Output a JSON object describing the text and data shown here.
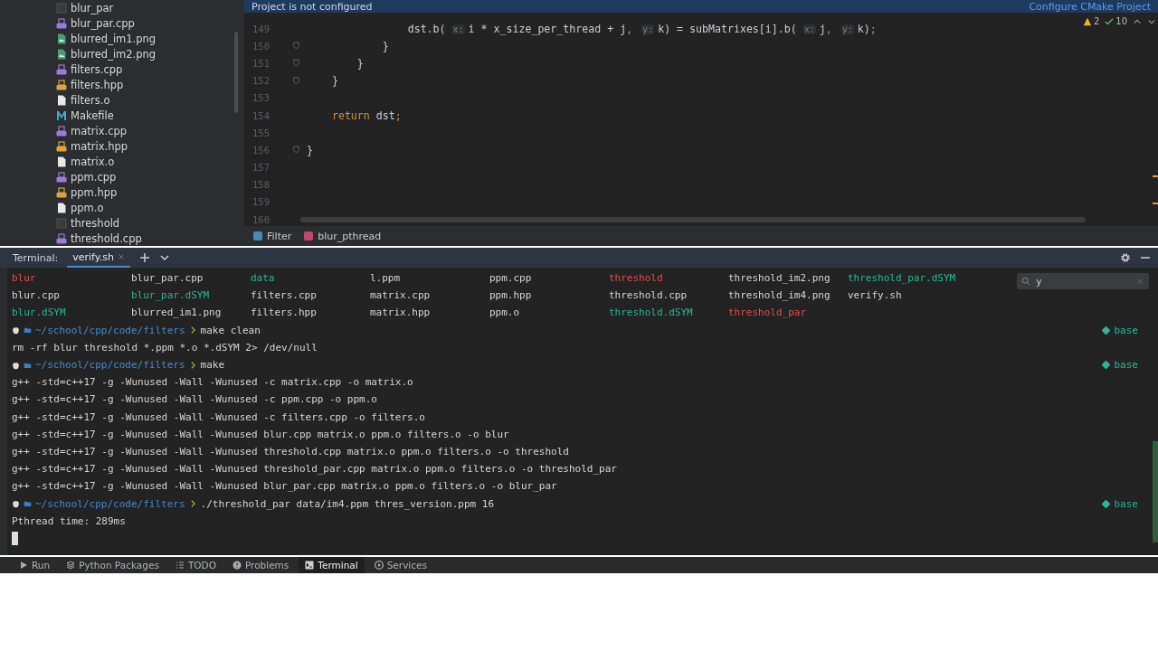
{
  "project_tree": {
    "items": [
      {
        "name": "blur_par",
        "kind": "exec"
      },
      {
        "name": "blur_par.cpp",
        "kind": "cpp"
      },
      {
        "name": "blurred_im1.png",
        "kind": "png"
      },
      {
        "name": "blurred_im2.png",
        "kind": "png"
      },
      {
        "name": "filters.cpp",
        "kind": "cpp"
      },
      {
        "name": "filters.hpp",
        "kind": "hpp"
      },
      {
        "name": "filters.o",
        "kind": "obj"
      },
      {
        "name": "Makefile",
        "kind": "make"
      },
      {
        "name": "matrix.cpp",
        "kind": "cpp"
      },
      {
        "name": "matrix.hpp",
        "kind": "hpp"
      },
      {
        "name": "matrix.o",
        "kind": "obj"
      },
      {
        "name": "ppm.cpp",
        "kind": "cpp"
      },
      {
        "name": "ppm.hpp",
        "kind": "hpp"
      },
      {
        "name": "ppm.o",
        "kind": "obj"
      },
      {
        "name": "threshold",
        "kind": "exec"
      },
      {
        "name": "threshold.cpp",
        "kind": "cpp"
      }
    ]
  },
  "editor": {
    "banner": {
      "message": "Project is not configured",
      "action": "Configure CMake Project"
    },
    "inspections": {
      "warnings": "2",
      "typos": "10"
    },
    "lines": [
      {
        "number": "149",
        "fold": false,
        "tokens": [
          {
            "kind": "code",
            "text": "                dst.b("
          },
          {
            "kind": "hint",
            "text": "x:"
          },
          {
            "kind": "code",
            "text": "i * x_size_per_thread + j"
          },
          {
            "kind": "punct",
            "text": ","
          },
          {
            "kind": "hint",
            "text": "y:"
          },
          {
            "kind": "code",
            "text": "k) = subMatrixes[i].b("
          },
          {
            "kind": "hint",
            "text": "x:"
          },
          {
            "kind": "code",
            "text": "j"
          },
          {
            "kind": "punct",
            "text": ","
          },
          {
            "kind": "hint",
            "text": "y:"
          },
          {
            "kind": "code",
            "text": "k)"
          },
          {
            "kind": "punct",
            "text": ";"
          }
        ]
      },
      {
        "number": "150",
        "fold": true,
        "tokens": [
          {
            "kind": "code",
            "text": "            }"
          }
        ]
      },
      {
        "number": "151",
        "fold": true,
        "tokens": [
          {
            "kind": "code",
            "text": "        }"
          }
        ]
      },
      {
        "number": "152",
        "fold": true,
        "tokens": [
          {
            "kind": "code",
            "text": "    }"
          }
        ]
      },
      {
        "number": "153",
        "fold": false
      },
      {
        "number": "154",
        "fold": false,
        "tokens": [
          {
            "kind": "keyword",
            "text": "    return"
          },
          {
            "kind": "code",
            "text": " dst"
          },
          {
            "kind": "punct",
            "text": ";"
          }
        ]
      },
      {
        "number": "155",
        "fold": false
      },
      {
        "number": "156",
        "fold": true,
        "tokens": [
          {
            "kind": "code",
            "text": "}"
          }
        ]
      },
      {
        "number": "157",
        "fold": false
      },
      {
        "number": "158",
        "fold": false
      },
      {
        "number": "159",
        "fold": false
      },
      {
        "number": "160",
        "fold": false
      }
    ],
    "breadcrumbs": [
      {
        "label": "Filter",
        "kind": "class"
      },
      {
        "label": "blur_pthread",
        "kind": "function"
      }
    ]
  },
  "terminal": {
    "label": "Terminal:",
    "tabs": [
      {
        "label": "verify.sh",
        "selected": true
      }
    ],
    "find": {
      "value": "y"
    },
    "lines": [
      {
        "kind": "ls",
        "items": [
          {
            "text": "blur",
            "color": "#d9534f"
          },
          {
            "text": "blur_par.cpp",
            "color": "#d4d4d4"
          },
          {
            "text": "data",
            "color": "#2fb39a"
          },
          {
            "text": "l.ppm",
            "color": "#d4d4d4"
          },
          {
            "text": "ppm.cpp",
            "color": "#d4d4d4"
          },
          {
            "text": "threshold",
            "color": "#d9534f"
          },
          {
            "text": "threshold_im2.png",
            "color": "#d4d4d4"
          },
          {
            "text": "threshold_par.dSYM",
            "color": "#2fb39a"
          }
        ]
      },
      {
        "kind": "ls",
        "items": [
          {
            "text": "blur.cpp",
            "color": "#d4d4d4"
          },
          {
            "text": "blur_par.dSYM",
            "color": "#2fb39a"
          },
          {
            "text": "filters.cpp",
            "color": "#d4d4d4"
          },
          {
            "text": "matrix.cpp",
            "color": "#d4d4d4"
          },
          {
            "text": "ppm.hpp",
            "color": "#d4d4d4"
          },
          {
            "text": "threshold.cpp",
            "color": "#d4d4d4"
          },
          {
            "text": "threshold_im4.png",
            "color": "#d4d4d4"
          },
          {
            "text": "verify.sh",
            "color": "#d4d4d4"
          }
        ]
      },
      {
        "kind": "ls",
        "items": [
          {
            "text": "blur.dSYM",
            "color": "#2fb39a"
          },
          {
            "text": "blurred_im1.png",
            "color": "#d4d4d4"
          },
          {
            "text": "filters.hpp",
            "color": "#d4d4d4"
          },
          {
            "text": "matrix.hpp",
            "color": "#d4d4d4"
          },
          {
            "text": "ppm.o",
            "color": "#d4d4d4"
          },
          {
            "text": "threshold.dSYM",
            "color": "#2fb39a"
          },
          {
            "text": "threshold_par",
            "color": "#d9534f"
          }
        ]
      },
      {
        "kind": "prompt",
        "path": "~/school/cpp/code/filters",
        "command": "make clean",
        "env": "base"
      },
      {
        "kind": "output",
        "text": "rm -rf blur threshold *.ppm *.o *.dSYM 2> /dev/null"
      },
      {
        "kind": "prompt",
        "path": "~/school/cpp/code/filters",
        "command": "make",
        "env": "base"
      },
      {
        "kind": "output",
        "text": "g++ -std=c++17 -g -Wunused -Wall -Wunused -c matrix.cpp -o matrix.o"
      },
      {
        "kind": "output",
        "text": "g++ -std=c++17 -g -Wunused -Wall -Wunused -c ppm.cpp -o ppm.o"
      },
      {
        "kind": "output",
        "text": "g++ -std=c++17 -g -Wunused -Wall -Wunused -c filters.cpp -o filters.o"
      },
      {
        "kind": "output",
        "text": "g++ -std=c++17 -g -Wunused -Wall -Wunused blur.cpp matrix.o ppm.o filters.o -o blur"
      },
      {
        "kind": "output",
        "text": "g++ -std=c++17 -g -Wunused -Wall -Wunused threshold.cpp matrix.o ppm.o filters.o -o threshold"
      },
      {
        "kind": "output",
        "text": "g++ -std=c++17 -g -Wunused -Wall -Wunused threshold_par.cpp matrix.o ppm.o filters.o -o threshold_par"
      },
      {
        "kind": "output",
        "text": "g++ -std=c++17 -g -Wunused -Wall -Wunused blur_par.cpp matrix.o ppm.o filters.o -o blur_par"
      },
      {
        "kind": "prompt",
        "path": "~/school/cpp/code/filters",
        "command": "./threshold_par data/im4.ppm thres_version.ppm 16",
        "env": "base"
      },
      {
        "kind": "output",
        "text": "Pthread time: 289ms"
      },
      {
        "kind": "cursor"
      }
    ]
  },
  "tool_windows": [
    {
      "label": "Run",
      "kind": "run",
      "selected": false
    },
    {
      "label": "Python Packages",
      "kind": "packages",
      "selected": false
    },
    {
      "label": "TODO",
      "kind": "todo",
      "selected": false
    },
    {
      "label": "Problems",
      "kind": "problems",
      "selected": false
    },
    {
      "label": "Terminal",
      "kind": "terminal",
      "selected": true
    },
    {
      "label": "Services",
      "kind": "services",
      "selected": false
    }
  ]
}
